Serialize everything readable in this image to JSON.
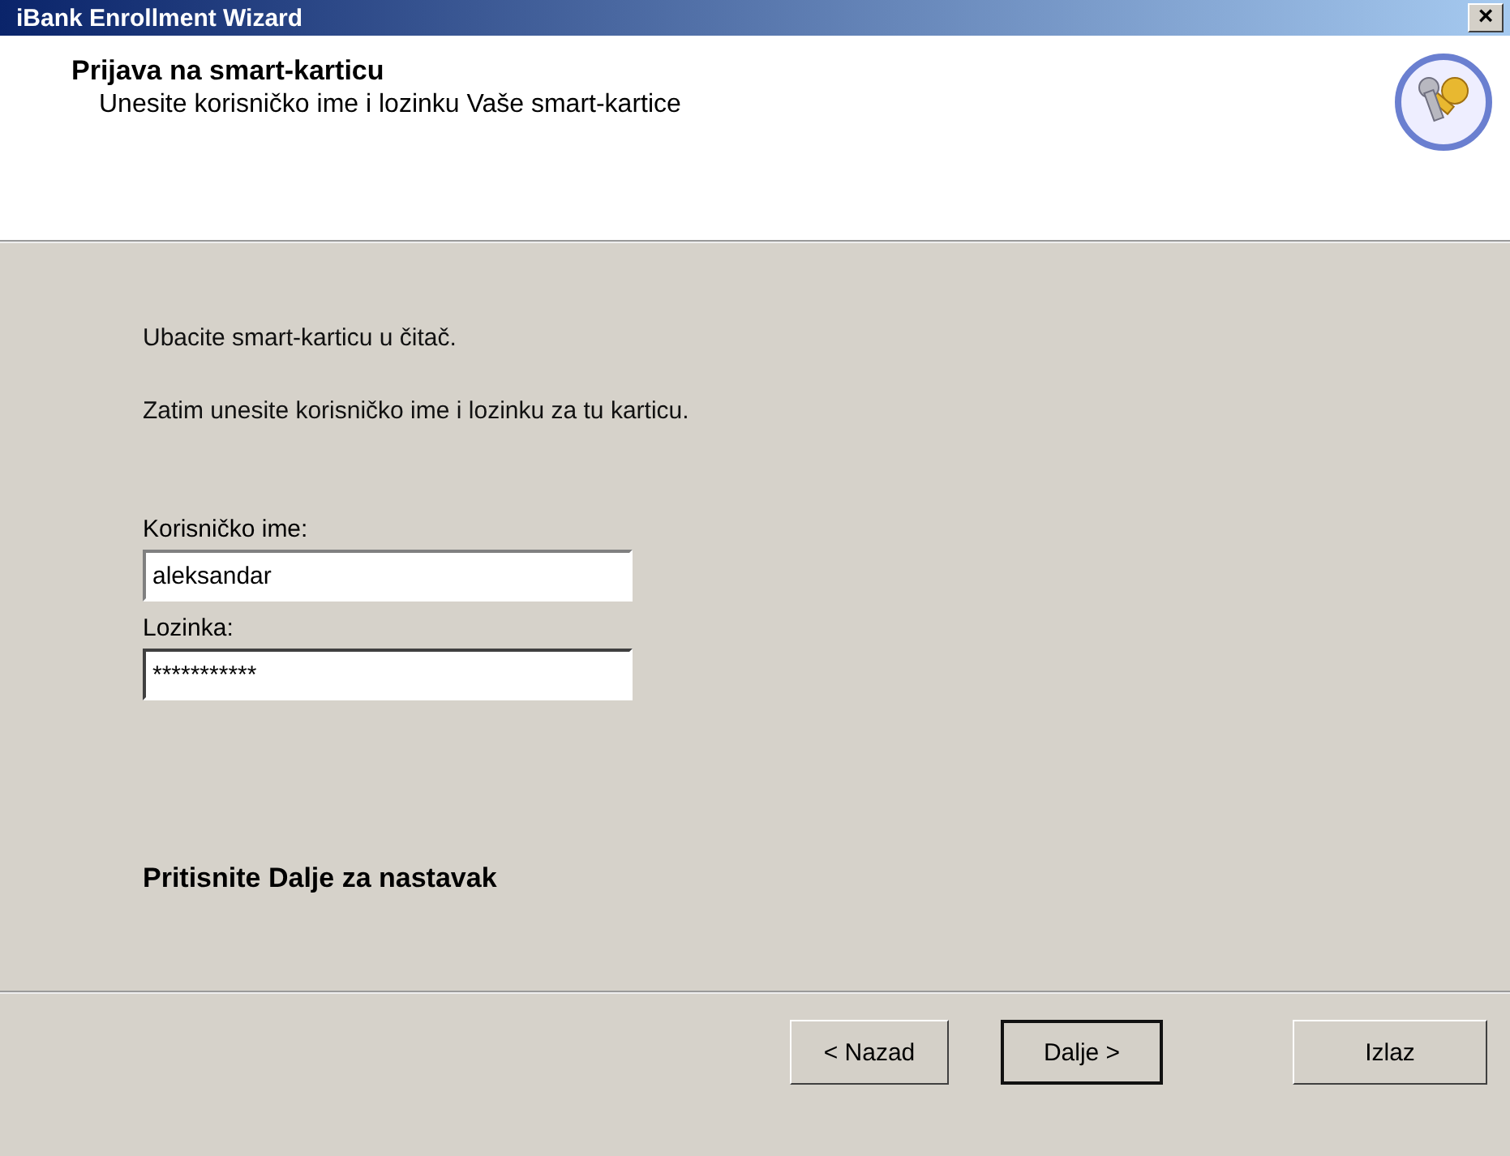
{
  "window": {
    "title": "iBank Enrollment Wizard",
    "close": "×"
  },
  "header": {
    "title": "Prijava na smart-karticu",
    "subtitle": "Unesite korisničko ime i lozinku Vaše smart-kartice"
  },
  "instructions": [
    "Ubacite smart-karticu u čitač.",
    "Zatim unesite korisničko ime i lozinku za tu karticu."
  ],
  "fields": [
    {
      "label": "Korisničko ime:",
      "value": "aleksandar",
      "focused": false
    },
    {
      "label": "Lozinka:",
      "value": "***********",
      "focused": true
    }
  ],
  "prompt": "Pritisnite Dalje za nastavak",
  "buttons": [
    {
      "label": "< Nazad",
      "default": false
    },
    {
      "label": "Dalje >",
      "default": true
    },
    {
      "label": "Izlaz",
      "default": false
    }
  ]
}
